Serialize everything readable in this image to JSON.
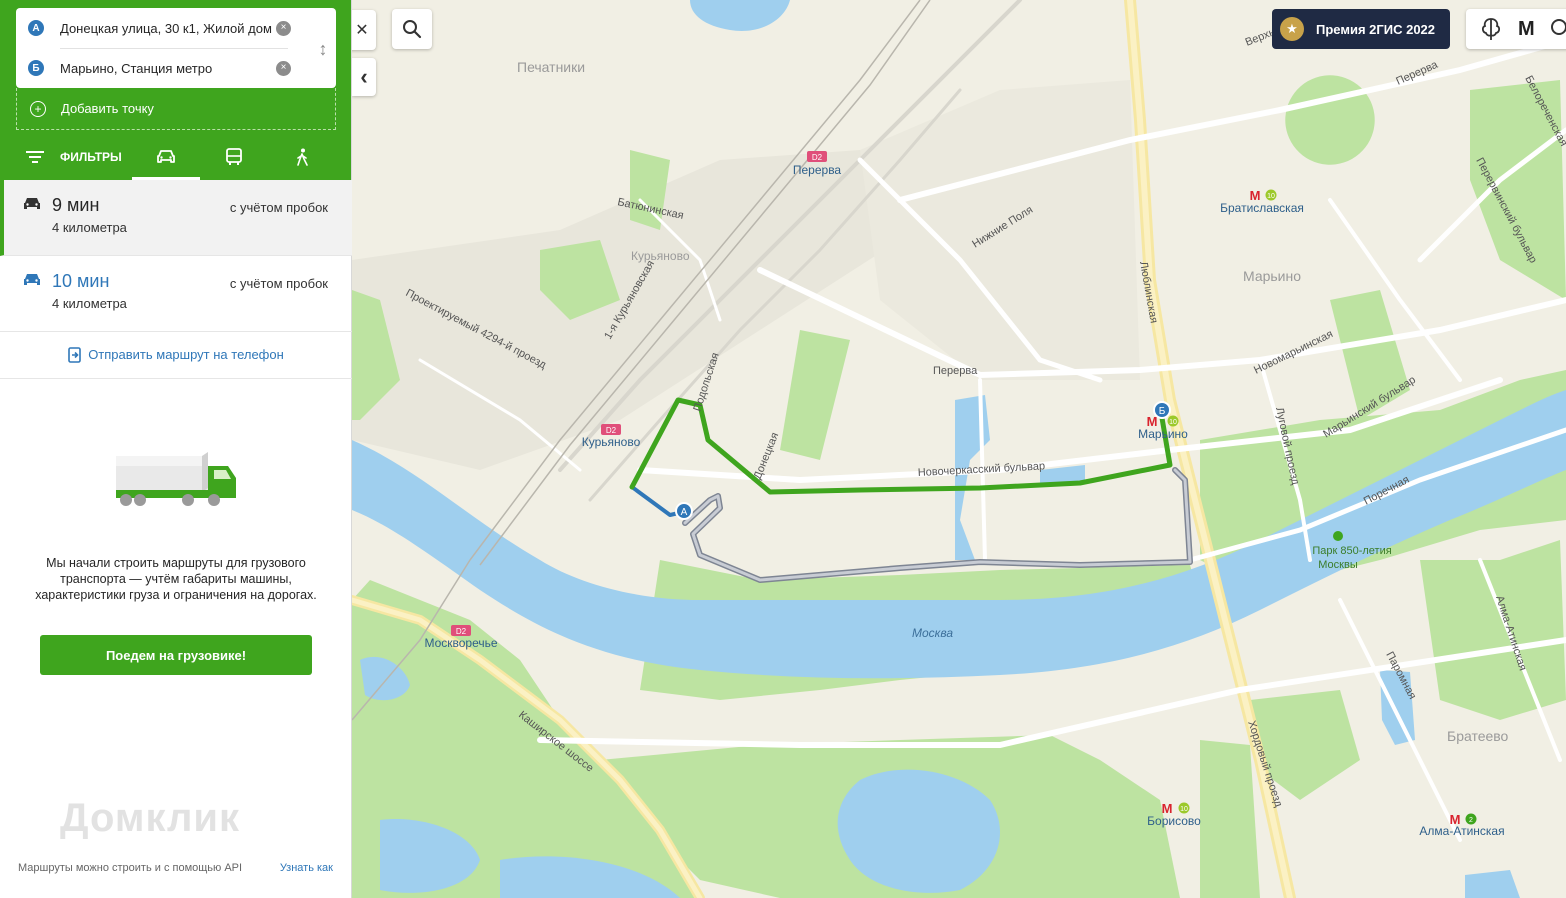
{
  "route_panel": {
    "point_a_label": "А",
    "point_a_value": "Донецкая улица, 30 к1, Жилой дом",
    "point_b_label": "Б",
    "point_b_value": "Марьино, Станция метро",
    "clear_glyph": "×",
    "swap_glyph": "↕",
    "add_point_label": "Добавить точку",
    "add_glyph": "+",
    "filters_label": "ФИЛЬТРЫ"
  },
  "routes": [
    {
      "time": "9 мин",
      "distance": "4 километра",
      "traffic": "с учётом пробок",
      "selected": true
    },
    {
      "time": "10 мин",
      "distance": "4 километра",
      "traffic": "с учётом пробок",
      "selected": false
    }
  ],
  "send_to_phone": "Отправить маршрут на телефон",
  "promo": {
    "text": "Мы начали строить маршруты для грузового транспорта — учтём габариты машины, характеристики груза и ограничения на дорогах.",
    "button": "Поедем на грузовике!"
  },
  "footer": {
    "api_text": "Маршруты можно строить и с помощью API",
    "learn_link": "Узнать как"
  },
  "watermark": "Домклик",
  "controls": {
    "close_glyph": "✕",
    "collapse_glyph": "‹",
    "award_label": "Премия 2ГИС 2022",
    "award_glyph": "★",
    "metro_glyph": "М"
  },
  "map": {
    "districts": [
      "Печатники",
      "Курьяново",
      "Марьино",
      "Братеево"
    ],
    "streets": [
      "Батюнинская",
      "1-я Курьяновская",
      "Проектируемый 4294-й проезд",
      "Подольская",
      "Донецкая",
      "Нижние Поля",
      "Перерва",
      "Новочеркасский бульвар",
      "Люблинская",
      "Новомарьинская",
      "Луговой проезд",
      "Марьинский бульвар",
      "Поречная",
      "Перервинский бульвар",
      "Белореченская",
      "Верхние Поля",
      "Каширское шоссе",
      "Хордовый проезд",
      "Алма-Атинская",
      "Паромная",
      "Перерва"
    ],
    "river": "Москва",
    "park": "Парк 850-летия Москвы",
    "stations": [
      {
        "name": "Перерва",
        "badge": "D2"
      },
      {
        "name": "Курьяново",
        "badge": "D2"
      },
      {
        "name": "Москворечье",
        "badge": "D2"
      },
      {
        "name": "Братиславская",
        "badge": "10"
      },
      {
        "name": "Марьино",
        "badge": "10"
      },
      {
        "name": "Борисово",
        "badge": "10"
      },
      {
        "name": "Алма-Атинская",
        "badge": "2"
      }
    ],
    "marker_a": "А",
    "marker_b": "Б",
    "colors": {
      "main_route": "#3fa51e",
      "alt_route": "#9aa0ab",
      "walk_segment": "#2f77b8",
      "water": "#9fcfee",
      "park": "#bde3a1",
      "land": "#f1efe4"
    }
  }
}
